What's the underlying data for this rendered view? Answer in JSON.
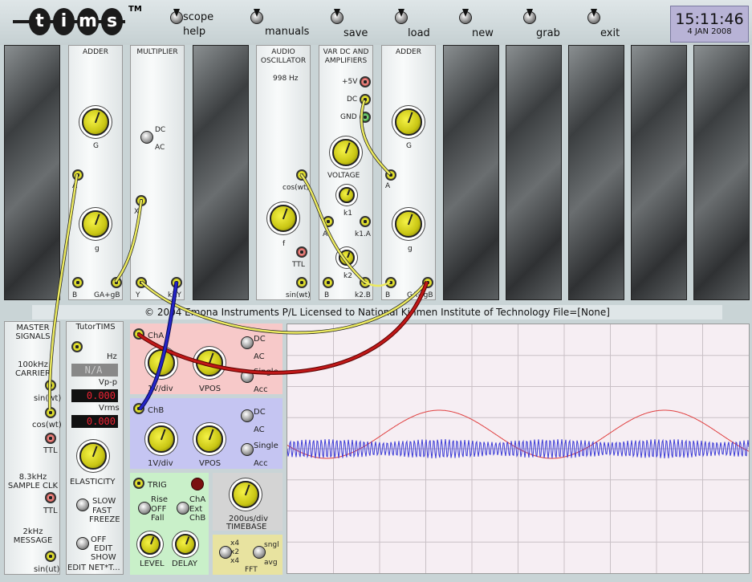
{
  "toolbar": {
    "logo": "tims",
    "tm": "TM",
    "buttons": [
      {
        "label": "scope",
        "label2": "help"
      },
      {
        "label": "manuals"
      },
      {
        "label": "save"
      },
      {
        "label": "load"
      },
      {
        "label": "new"
      },
      {
        "label": "grab"
      },
      {
        "label": "exit"
      }
    ],
    "clock_time": "15:11:46",
    "clock_date": "4 JAN 2008"
  },
  "modules": {
    "adder1": {
      "title": "ADDER",
      "g": "G",
      "a": "A",
      "gsmall": "g",
      "b": "B",
      "out": "GA+gB"
    },
    "multiplier": {
      "title": "MULTIPLIER",
      "dc": "DC",
      "ac": "AC",
      "x": "X",
      "y": "Y",
      "out": "kXY"
    },
    "audio_osc": {
      "title": "AUDIO\nOSCILLATOR",
      "freq": "998 Hz",
      "cos": "cos(wt)",
      "f": "f",
      "ttl": "TTL",
      "sin": "sin(wt)"
    },
    "var_dc": {
      "title": "VAR DC AND\nAMPLIFIERS",
      "plus5": "+5V",
      "dc": "DC",
      "gnd": "GND",
      "voltage": "VOLTAGE",
      "k1": "k1",
      "a": "A",
      "k1a": "k1.A",
      "k2": "k2",
      "b": "B",
      "k2b": "k2.B"
    },
    "adder2": {
      "title": "ADDER",
      "g": "G",
      "a": "A",
      "gsmall": "g",
      "b": "B",
      "out": "GA+gB"
    }
  },
  "copyright": "© 2004 Emona Instruments P/L  Licensed to National Kinmen Institute of Technology    File=[None]",
  "master": {
    "title": "MASTER\nSIGNALS",
    "carrier": "100kHz\nCARRIER",
    "sin1": "sin(wt)",
    "cos1": "cos(wt)",
    "ttl1": "TTL",
    "sample": "8.3kHz\nSAMPLE CLK",
    "ttl2": "TTL",
    "message": "2kHz\nMESSAGE",
    "sin2": "sin(ut)"
  },
  "tutortims": {
    "title": "TutorTIMS",
    "hz": "Hz",
    "hz_val": "N/A",
    "vpp": "Vp-p",
    "vpp_val": "0.000",
    "vrms": "Vrms",
    "vrms_val": "0.000",
    "elasticity": "ELASTICITY",
    "slow": "SLOW",
    "fast": "FAST",
    "freeze": "FREEZE",
    "off": "OFF",
    "edit": "EDIT",
    "show": "SHOW",
    "editnet": "EDIT NET*T..."
  },
  "scope_ctrl": {
    "cha": "ChA",
    "cha_vdiv": "1V/div",
    "cha_vpos": "VPOS",
    "cha_dc": "DC",
    "cha_ac": "AC",
    "cha_single": "Single",
    "cha_acc": "Acc",
    "chb": "ChB",
    "chb_vdiv": "1V/div",
    "chb_vpos": "VPOS",
    "chb_dc": "DC",
    "chb_ac": "AC",
    "chb_single": "Single",
    "chb_acc": "Acc",
    "trig": "TRIG",
    "rise": "Rise",
    "off": "OFF",
    "fall": "Fall",
    "tcha": "ChA",
    "ext": "Ext",
    "tchb": "ChB",
    "level": "LEVEL",
    "delay": "DELAY",
    "timebase_val": "200us/div",
    "timebase": "TIMEBASE",
    "x4": "x4",
    "x2": "x2",
    "x4b": "x4",
    "sngl": "sngl",
    "avg": "avg",
    "fft": "FFT"
  },
  "colors": {
    "cha_panel": "#f7c9c9",
    "chb_panel": "#c5c5f2",
    "trig_panel": "#c9f0c9",
    "fft_panel": "#e8e3a0",
    "trace_a": "#e04040",
    "trace_b": "#3a3ad6"
  }
}
